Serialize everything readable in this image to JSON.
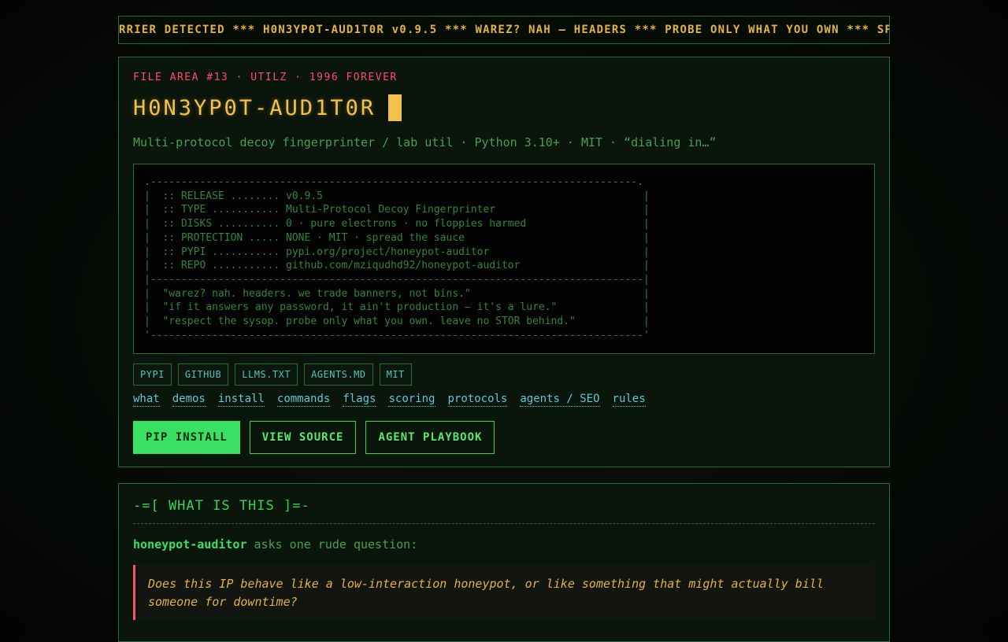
{
  "ticker": "RRIER DETECTED *** H0N3YP0T-AUD1T0R v0.9.5 *** WAREZ? NAH — HEADERS *** PROBE ONLY WHAT YOU OWN *** SPREAD THE SAU",
  "hero": {
    "kicker": "FILE AREA #13 · UTILZ · 1996 FOREVER",
    "title": "H0N3YP0T-AUD1T0R",
    "subtitle": "Multi-protocol decoy fingerprinter / lab util · Python 3.10+ · MIT · “dialing in…”",
    "infobox": ".-------------------------------------------------------------------------------.\n|  :: RELEASE ........ v0.9.5                                                    |\n|  :: TYPE ........... Multi-Protocol Decoy Fingerprinter                        |\n|  :: DISKS .......... 0 · pure electrons · no floppies harmed                   |\n|  :: PROTECTION ..... NONE · MIT · spread the sauce                             |\n|  :: PYPI ........... pypi.org/project/honeypot-auditor                         |\n|  :: REPO ........... github.com/mziqudhd92/honeypot-auditor                    |\n|--------------------------------------------------------------------------------|\n|  \"warez? nah. headers. we trade banners, not bins.\"                            |\n|  \"if it answers any password, it ain't production — it's a lure.\"              |\n|  \"respect the sysop. probe only what you own. leave no STOR behind.\"           |\n'--------------------------------------------------------------------------------'",
    "badges": [
      "PYPI",
      "GITHUB",
      "LLMS.TXT",
      "AGENTS.MD",
      "MIT"
    ],
    "links": [
      "what",
      "demos",
      "install",
      "commands",
      "flags",
      "scoring",
      "protocols",
      "agents / SEO",
      "rules"
    ],
    "buttons": {
      "pip_install": "PIP INSTALL",
      "view_source": "VIEW SOURCE",
      "agent_playbook": "AGENT PLAYBOOK"
    }
  },
  "what_section": {
    "title": "-=[ WHAT IS THIS ]=-",
    "lead_name": "honeypot-auditor",
    "lead_rest": " asks one rude question:",
    "quote": "Does this IP behave like a low-interaction honeypot, or like something that might actually bill someone for downtime?"
  },
  "colors": {
    "background": "#050a05",
    "green": "#39d353",
    "amber": "#f3c14a",
    "red": "#ff4d6d",
    "cyan": "#5ac8d8"
  }
}
